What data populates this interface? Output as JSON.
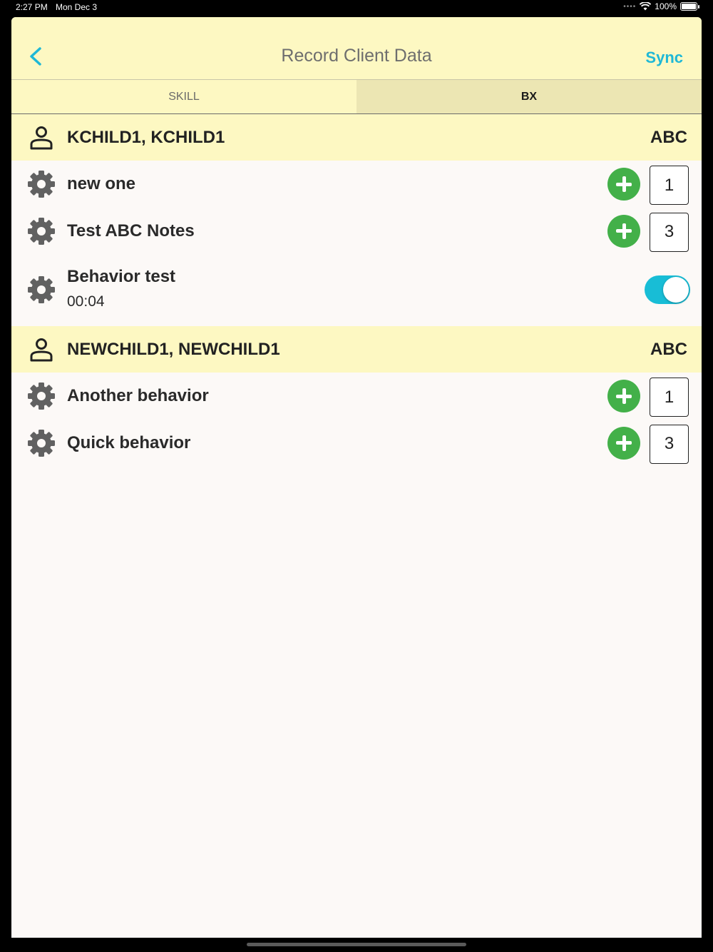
{
  "status_bar": {
    "time": "2:27 PM",
    "date": "Mon Dec 3",
    "battery": "100%"
  },
  "nav": {
    "title": "Record Client Data",
    "sync_label": "Sync"
  },
  "tabs": [
    {
      "label": "SKILL",
      "selected": false
    },
    {
      "label": "BX",
      "selected": true
    }
  ],
  "clients": [
    {
      "name": "KCHILD1, KCHILD1",
      "tag": "ABC",
      "behaviors": [
        {
          "label": "new one",
          "count": "1"
        },
        {
          "label": "Test ABC Notes",
          "count": "3"
        },
        {
          "label": "Behavior test",
          "duration": "00:04",
          "toggle_on": true
        }
      ]
    },
    {
      "name": "NEWCHILD1, NEWCHILD1",
      "tag": "ABC",
      "behaviors": [
        {
          "label": "Another behavior",
          "count": "1"
        },
        {
          "label": "Quick behavior",
          "count": "3"
        }
      ]
    }
  ],
  "colors": {
    "header_bg": "#fdf8c2",
    "accent": "#1fb8d6",
    "add_green": "#43b049",
    "toggle_on": "#18bdd6"
  },
  "icons": {
    "back": "chevron-left-icon",
    "person": "person-icon",
    "gear": "gear-icon",
    "add": "plus-circle-icon"
  }
}
